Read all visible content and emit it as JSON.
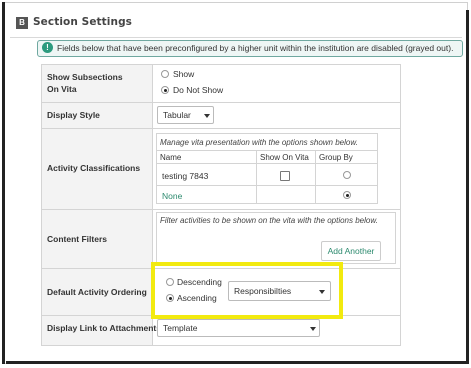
{
  "section": {
    "badge": "B",
    "title": "Section Settings"
  },
  "info": {
    "icon": "!",
    "text": "Fields below that have been preconfigured by a higher unit within the institution are disabled (grayed out)."
  },
  "rows": {
    "show_subsections": {
      "label_line1": "Show Subsections",
      "label_line2": "On Vita",
      "options": [
        "Show",
        "Do Not Show"
      ],
      "selected": "Do Not Show"
    },
    "display_style": {
      "label": "Display Style",
      "value": "Tabular"
    },
    "activity_classifications": {
      "label": "Activity Classifications",
      "note": "Manage vita presentation with the options shown below.",
      "columns": [
        "Name",
        "Show On Vita",
        "Group By"
      ],
      "items": [
        {
          "name": "testing 7843",
          "show_on_vita": false,
          "group_by": false
        },
        {
          "name": "None",
          "show_on_vita": null,
          "group_by": true
        }
      ]
    },
    "content_filters": {
      "label": "Content Filters",
      "note": "Filter activities to be shown on the vita with the options below.",
      "add_button": "Add Another"
    },
    "default_activity_ordering": {
      "label": "Default Activity Ordering",
      "options": [
        "Descending",
        "Ascending"
      ],
      "selected": "Ascending",
      "order_field": "Responsibilties"
    },
    "display_link": {
      "label": "Display Link to Attachments",
      "value": "Template"
    }
  },
  "colors": {
    "highlight": "#f2ea0f",
    "accent": "#2c8a6e"
  }
}
